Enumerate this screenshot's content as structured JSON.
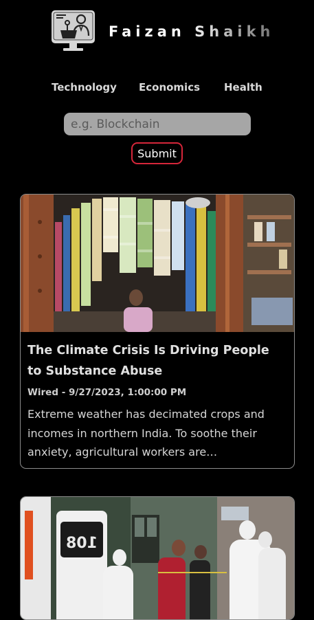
{
  "brand": {
    "name": "Faizan Shaikh"
  },
  "nav": {
    "items": [
      {
        "label": "Technology"
      },
      {
        "label": "Economics"
      },
      {
        "label": "Health"
      }
    ]
  },
  "search": {
    "placeholder": "e.g. Blockchain",
    "value": ""
  },
  "submit": {
    "label": "Submit"
  },
  "articles": [
    {
      "title": "The Climate Crisis Is Driving People to Substance Abuse",
      "meta": "Wired - 9/27/2023, 1:00:00 PM",
      "description": "Extreme weather has decimated crops and incomes in northern India. To soothe their anxiety, agricultural workers are…",
      "image": "shop-stall-photo"
    },
    {
      "image": "ambulance-health-workers-photo",
      "image_text": "108"
    }
  ],
  "colors": {
    "background": "#000000",
    "input_bg": "#a6a6a6",
    "submit_border": "#d6263a",
    "card_border": "#8d8d8d"
  },
  "icons": {
    "logo": "presenter-monitor-icon"
  }
}
